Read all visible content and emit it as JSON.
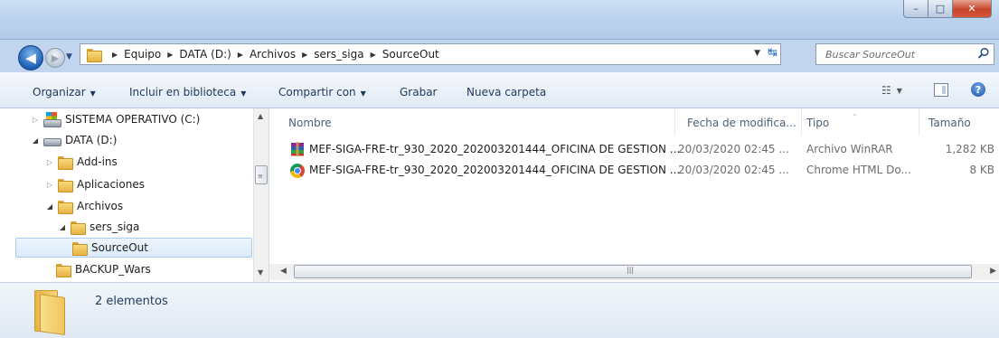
{
  "window": {
    "caption_min": "–",
    "caption_max": "□",
    "caption_close": "✕"
  },
  "nav": {
    "back_glyph": "◀",
    "forward_glyph": "▶",
    "recent_glyph": "▼",
    "breadcrumb": [
      "Equipo",
      "DATA (D:)",
      "Archivos",
      "sers_siga",
      "SourceOut"
    ],
    "separator": "▶",
    "dropdown_glyph": "▼",
    "refresh_glyph": "↹",
    "search_placeholder": "Buscar SourceOut"
  },
  "toolbar": {
    "organize": "Organizar",
    "include_library": "Incluir en biblioteca",
    "share_with": "Compartir con",
    "burn": "Grabar",
    "new_folder": "Nueva carpeta",
    "dropdown_glyph": "▼",
    "views_glyph": "☷",
    "help_glyph": "?"
  },
  "tree": {
    "items": [
      {
        "label": "SISTEMA OPERATIVO (C:)",
        "expander": "▷",
        "icon": "os-drive-icon"
      },
      {
        "label": "DATA (D:)",
        "expander": "◢",
        "icon": "drive-icon"
      },
      {
        "label": "Add-ins",
        "expander": "▷",
        "icon": "folder-icon"
      },
      {
        "label": "Aplicaciones",
        "expander": "▷",
        "icon": "folder-icon"
      },
      {
        "label": "Archivos",
        "expander": "◢",
        "icon": "folder-icon"
      },
      {
        "label": "sers_siga",
        "expander": "◢",
        "icon": "folder-icon"
      },
      {
        "label": "SourceOut",
        "expander": "",
        "icon": "folder-icon",
        "selected": true
      },
      {
        "label": "BACKUP_Wars",
        "expander": "",
        "icon": "folder-icon"
      }
    ]
  },
  "scroll": {
    "up": "▲",
    "down": "▼",
    "left": "◀",
    "right": "▶",
    "v_grip": "≡",
    "h_grip": "|||"
  },
  "filelist": {
    "columns": {
      "name": "Nombre",
      "date": "Fecha de modifica...",
      "type": "Tipo",
      "size": "Tamaño"
    },
    "sort_glyph": "⌄",
    "rows": [
      {
        "name": "MEF-SIGA-FRE-tr_930_2020_202003201444_OFICINA DE GESTION ...",
        "date": "20/03/2020 02:45 ...",
        "type": "Archivo WinRAR",
        "size": "1,282 KB",
        "icon": "winrar-icon"
      },
      {
        "name": "MEF-SIGA-FRE-tr_930_2020_202003201444_OFICINA DE GESTION ...",
        "date": "20/03/2020 02:45 ...",
        "type": "Chrome HTML Do...",
        "size": "8 KB",
        "icon": "chrome-icon"
      }
    ]
  },
  "details": {
    "count": "2 elementos"
  },
  "colors": {
    "titlebar": "#c1d5ee",
    "selection": "#dbeafb",
    "toolbar_text": "#1e395b"
  }
}
